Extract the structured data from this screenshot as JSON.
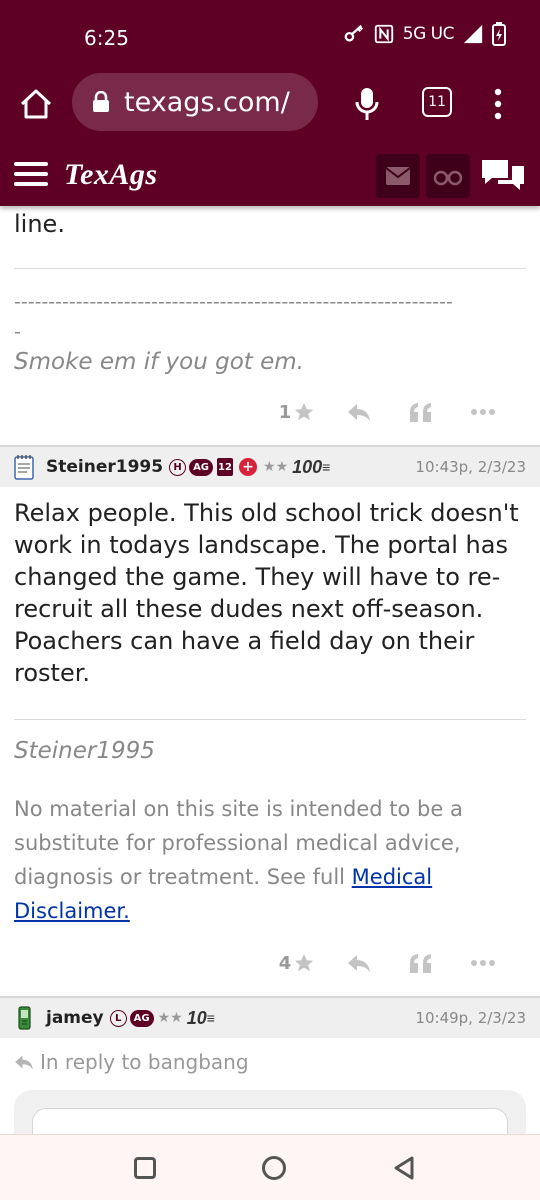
{
  "status": {
    "time": "6:25",
    "network": "5G UC"
  },
  "browser": {
    "url": "texags.com/",
    "tab_count": "11"
  },
  "site": {
    "logo": "TexAgs"
  },
  "post_prev": {
    "text_tail": "line.",
    "signature_dashes": "----------------------------------------------------------------",
    "signature_dash_tail": "-",
    "signature": "Smoke em if you got em.",
    "likes": "1"
  },
  "post_steiner": {
    "username": "Steiner1995",
    "badge_h": "H",
    "badge_ag": "AG",
    "badge_12": "12",
    "stars": "★★",
    "post_count": "100",
    "timestamp": "10:43p, 2/3/23",
    "body": "Relax people. This old school trick doesn't work in todays landscape. The portal has changed the game. They will have to re-recruit all these dudes next off-season. Poachers can have a field day on their roster.",
    "signature": "Steiner1995",
    "disclaimer": "No material on this site is intended to be a substitute for professional medical advice, diagnosis or treatment. See full ",
    "disclaimer_link": "Medical Disclaimer.",
    "likes": "4"
  },
  "post_jamey": {
    "username": "jamey",
    "badge_l": "L",
    "badge_ag": "AG",
    "stars": "★★",
    "post_count": "10",
    "timestamp": "10:49p, 2/3/23",
    "reply_to": "In reply to bangbang"
  },
  "colors": {
    "brand": "#5d0024",
    "link": "#0033aa"
  }
}
